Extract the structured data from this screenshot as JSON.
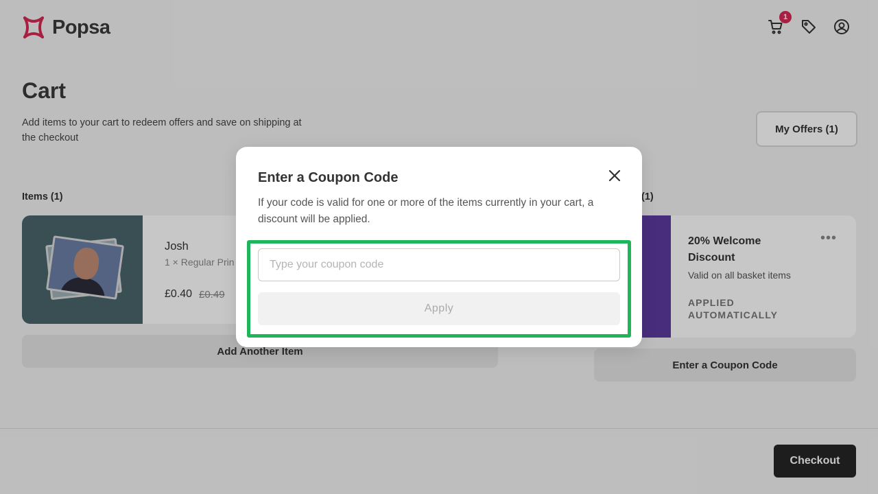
{
  "header": {
    "logo_text": "Popsa",
    "cart_badge": "1",
    "brand_color": "#d62a55"
  },
  "cart": {
    "title": "Cart",
    "subtitle": "Add items to your cart to redeem offers and save on shipping at the checkout",
    "my_offers_label": "My Offers (1)",
    "items_label": "Items (1)",
    "offers_label_fragment": "(1)"
  },
  "item": {
    "name": "Josh",
    "description": "1 × Regular Prin",
    "price": "£0.40",
    "old_price": "£0.49"
  },
  "add_item_label": "Add Another Item",
  "offer": {
    "title": "20% Welcome Discount",
    "description": "Valid on all basket items",
    "status": "APPLIED AUTOMATICALLY",
    "menu": "•••",
    "stripe_color": "#5e3aa0"
  },
  "coupon_button_label": "Enter a Coupon Code",
  "checkout_label": "Checkout",
  "modal": {
    "title": "Enter a Coupon Code",
    "text": "If your code is valid for one or more of the items currently in your cart, a discount will be applied.",
    "input_placeholder": "Type your coupon code",
    "input_value": "",
    "apply_label": "Apply",
    "highlight_color": "#1fb55a"
  },
  "icons": [
    "cart-icon",
    "tag-icon",
    "account-icon",
    "close-icon",
    "more-icon"
  ]
}
